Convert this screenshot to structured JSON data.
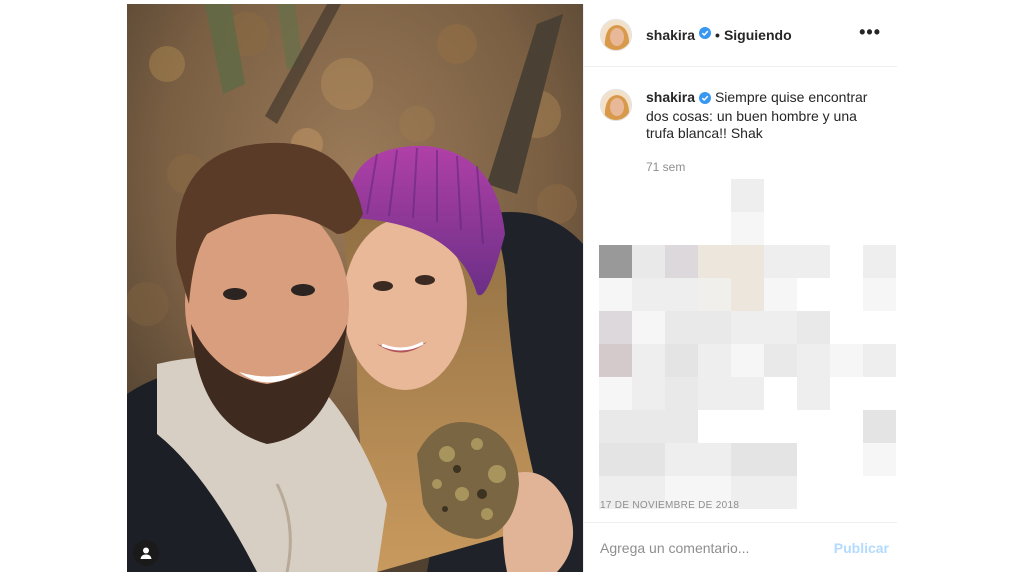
{
  "header": {
    "username": "shakira",
    "separator": "•",
    "follow_label": "Siguiendo",
    "more_glyph": "•••"
  },
  "caption": {
    "username": "shakira",
    "text": "Siempre quise encontrar dos cosas: un buen hombre y una trufa blanca!! Shak",
    "time": "71 sem"
  },
  "post": {
    "date": "17 de noviembre de 2018"
  },
  "comment": {
    "placeholder": "Agrega un comentario...",
    "publish_label": "Publicar"
  },
  "icons": {
    "verified": "verified-badge-icon",
    "more": "more-options-icon",
    "user_tag": "user-tag-icon"
  },
  "colors": {
    "verified": "#3897f0",
    "publish_disabled": "#b3dbff",
    "meta_text": "#8e8e8e",
    "divider": "#efefef"
  }
}
